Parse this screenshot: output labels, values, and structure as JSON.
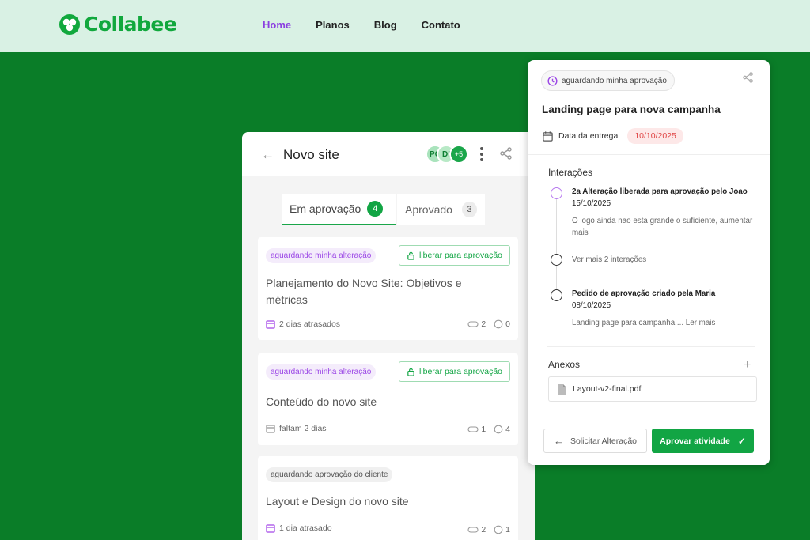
{
  "brand": {
    "name": "Collabee",
    "color": "#11a83d"
  },
  "nav": {
    "items": [
      "Home",
      "Planos",
      "Blog",
      "Contato"
    ],
    "active": "Home"
  },
  "project": {
    "title": "Novo site",
    "avatars": [
      "PC",
      "DI",
      "+5"
    ],
    "tabs": [
      {
        "label": "Em aprovação",
        "count": "4"
      },
      {
        "label": "Aprovado",
        "count": "3"
      }
    ],
    "tasks": [
      {
        "status": "aguardando minha alteração",
        "action": "liberar para aprovação",
        "title": "Planejamento do Novo Site: Objetivos e métricas",
        "meta": "2 dias atrasados",
        "attachments": "2",
        "comments": "0"
      },
      {
        "status": "aguardando minha alteração",
        "action": "liberar para aprovação",
        "title": "Conteúdo do novo site",
        "meta": "faltam 2 dias",
        "attachments": "1",
        "comments": "4"
      },
      {
        "status": "aguardando aprovação do cliente",
        "title": "Layout e Design do novo site",
        "meta": "1 dia atrasado",
        "attachments": "2",
        "comments": "1"
      }
    ]
  },
  "detail": {
    "status": "aguardando minha aprovação",
    "title": "Landing page para nova campanha",
    "due_label": "Data da entrega",
    "due_value": "10/10/2025",
    "interactions_label": "Interações",
    "timeline": [
      {
        "title": "2a Alteração liberada para aprovação pelo Joao",
        "date": "15/10/2025",
        "text": "O logo ainda nao esta grande o suficiente, aumentar mais"
      },
      {
        "title": "Ver mais 2 interações"
      },
      {
        "title": "Pedido de aprovação criado pela Maria",
        "date": "08/10/2025",
        "text": "Landing page para campanha ... Ler mais"
      }
    ],
    "attachments_label": "Anexos",
    "attachment_file": "Layout-v2-final.pdf",
    "btn_request": "Solicitar Alteração",
    "btn_approve": "Aprovar atividade"
  },
  "colors": {
    "accent_green": "#12a544",
    "purple": "#9b46e6",
    "due_red": "#e04444",
    "background": "#0a7d28"
  }
}
